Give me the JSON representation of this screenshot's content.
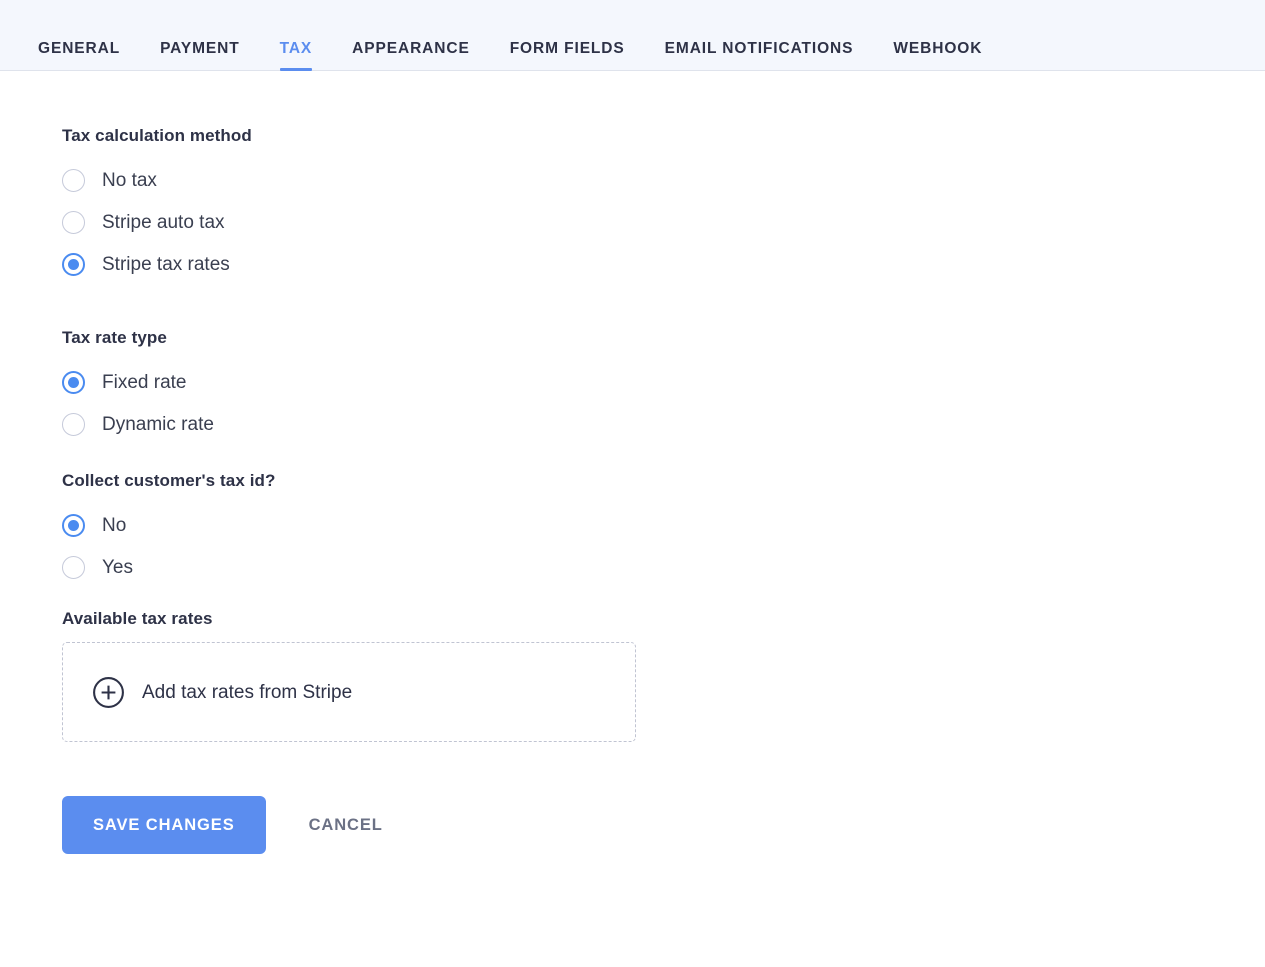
{
  "tabs": [
    {
      "label": "GENERAL",
      "active": false
    },
    {
      "label": "PAYMENT",
      "active": false
    },
    {
      "label": "TAX",
      "active": true
    },
    {
      "label": "APPEARANCE",
      "active": false
    },
    {
      "label": "FORM FIELDS",
      "active": false
    },
    {
      "label": "EMAIL NOTIFICATIONS",
      "active": false
    },
    {
      "label": "WEBHOOK",
      "active": false
    }
  ],
  "sections": {
    "tax_calculation_method": {
      "title": "Tax calculation method",
      "options": [
        {
          "label": "No tax",
          "selected": false
        },
        {
          "label": "Stripe auto tax",
          "selected": false
        },
        {
          "label": "Stripe tax rates",
          "selected": true
        }
      ]
    },
    "tax_rate_type": {
      "title": "Tax rate type",
      "options": [
        {
          "label": "Fixed rate",
          "selected": true
        },
        {
          "label": "Dynamic rate",
          "selected": false
        }
      ]
    },
    "collect_tax_id": {
      "title": "Collect customer's tax id?",
      "options": [
        {
          "label": "No",
          "selected": true
        },
        {
          "label": "Yes",
          "selected": false
        }
      ]
    },
    "available_tax_rates": {
      "title": "Available tax rates",
      "add_label": "Add tax rates from Stripe",
      "add_icon": "plus-circle-icon"
    }
  },
  "actions": {
    "save_label": "SAVE CHANGES",
    "cancel_label": "CANCEL"
  },
  "colors": {
    "accent": "#5b8def",
    "radio_selected": "#4a8bf0",
    "heading": "#2e3247",
    "label": "#3a3f50",
    "muted": "#6b7185",
    "tabbar_bg": "#f4f7fd",
    "dashed_border": "#c0c4d2"
  }
}
